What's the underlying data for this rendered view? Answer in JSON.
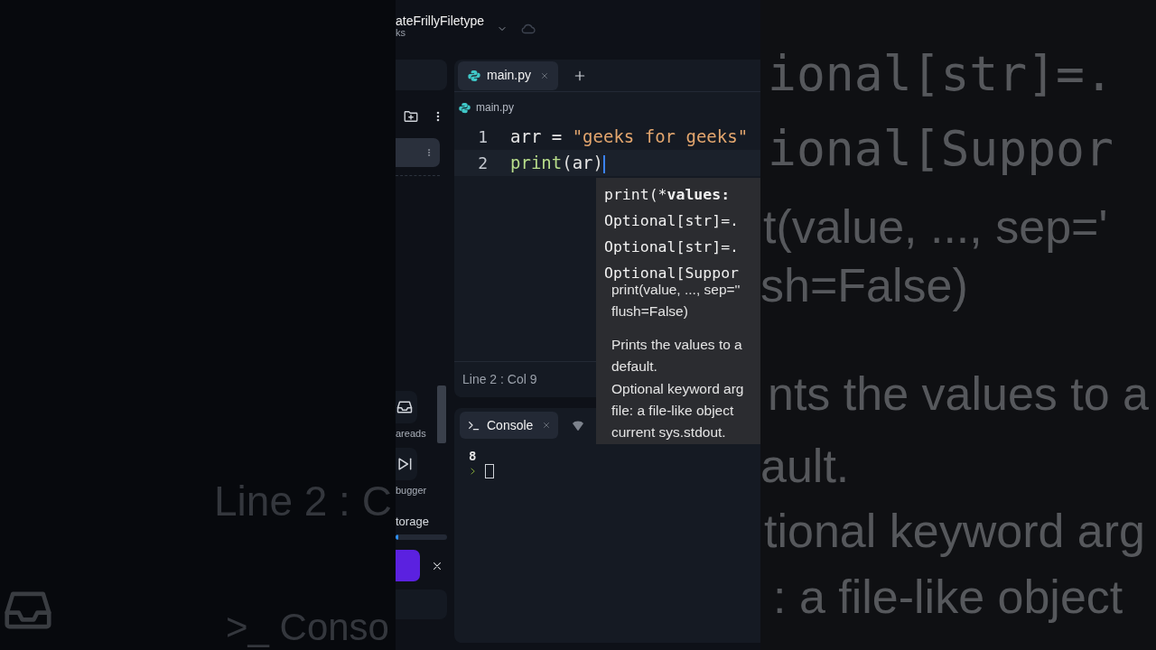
{
  "backdrop_left": {
    "lines": [
      "Line 2 : C",
      ">_ Conso"
    ]
  },
  "backdrop_right": {
    "lines": [
      "ional[str]=.",
      "ional[Suppor",
      "t(value, ..., sep='",
      "sh=False)",
      "nts the values to a",
      "ault.",
      "tional keyword arg",
      ":  a file-like object"
    ]
  },
  "header": {
    "title": "ateFrillyFiletype",
    "subtitle": "ks"
  },
  "sidebar": {
    "tools": [
      {
        "label": "areads"
      },
      {
        "label": "bugger"
      }
    ],
    "storage": {
      "label": "torage",
      "level": 0.05
    }
  },
  "editor": {
    "tabs": [
      {
        "label": "main.py",
        "selected": true
      }
    ],
    "breadcrumb": "main.py",
    "lines": [
      {
        "number": "1",
        "active": false,
        "tokens": [
          {
            "text": "arr",
            "kind": "name"
          },
          {
            "text": " = ",
            "kind": "plain"
          },
          {
            "text": "\"geeks for geeks\"",
            "kind": "string"
          }
        ]
      },
      {
        "number": "2",
        "active": true,
        "tokens": [
          {
            "text": "print",
            "kind": "func"
          },
          {
            "text": "(",
            "kind": "paren"
          },
          {
            "text": "ar",
            "kind": "name"
          },
          {
            "text": ")",
            "kind": "paren"
          }
        ]
      }
    ],
    "status": "Line 2 : Col 9"
  },
  "hint": {
    "signature": [
      [
        {
          "text": "print(*",
          "bold": false
        },
        {
          "text": "values:",
          "bold": true
        }
      ],
      [
        {
          "text": "Optional[str]=.",
          "bold": false
        }
      ],
      [
        {
          "text": "Optional[str]=.",
          "bold": false
        }
      ],
      [
        {
          "text": "Optional[Suppor",
          "bold": false
        }
      ]
    ],
    "doc": [
      [
        "print(value, ..., sep=''",
        "flush=False)"
      ],
      [
        "Prints the values to a",
        "default.",
        "Optional keyword arg",
        "file:  a file-like object",
        "current sys.stdout."
      ]
    ]
  },
  "console": {
    "tab": {
      "label": "Console",
      "selected": true
    },
    "output": [
      "8"
    ]
  }
}
